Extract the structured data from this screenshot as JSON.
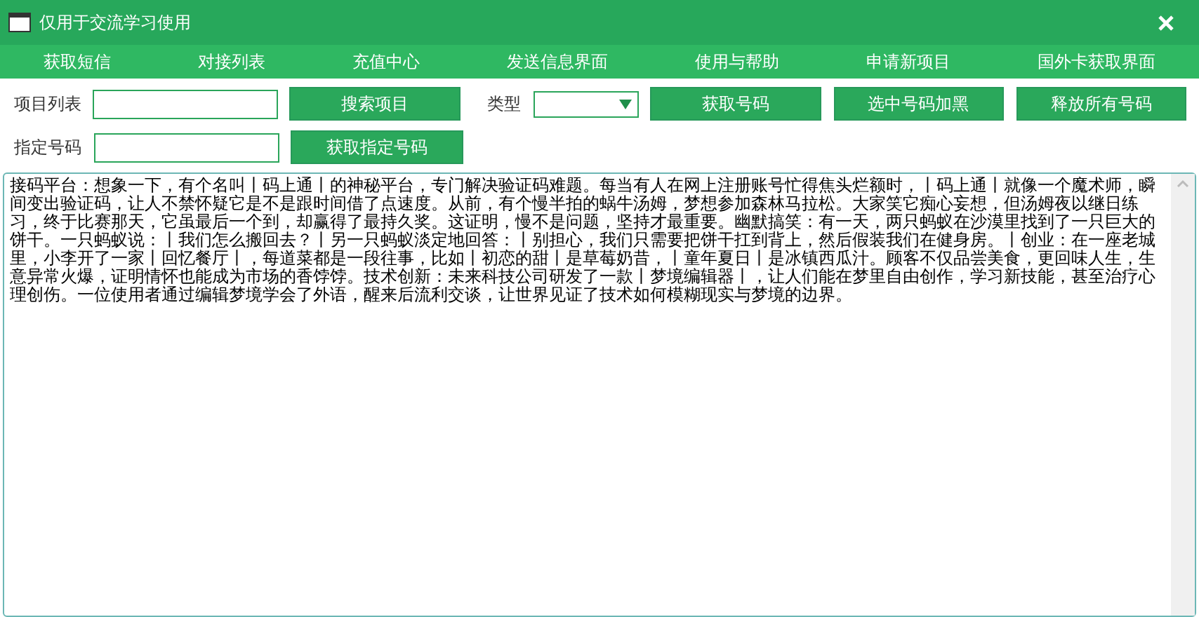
{
  "window": {
    "title": "仅用于交流学习使用"
  },
  "menu": [
    {
      "label": "获取短信"
    },
    {
      "label": "对接列表"
    },
    {
      "label": "充值中心"
    },
    {
      "label": "发送信息界面"
    },
    {
      "label": "使用与帮助"
    },
    {
      "label": "申请新项目"
    },
    {
      "label": "国外卡获取界面"
    }
  ],
  "row1": {
    "project_label": "项目列表",
    "search_button": "搜索项目",
    "type_label": "类型",
    "buttons": [
      "获取号码",
      "选中号码加黑",
      "释放所有号码"
    ]
  },
  "row2": {
    "number_label": "指定号码",
    "button": "获取指定号码"
  },
  "log": {
    "text": "接码平台：想象一下，有个名叫丨码上通丨的神秘平台，专门解决验证码难题。每当有人在网上注册账号忙得焦头烂额时，丨码上通丨就像一个魔术师，瞬间变出验证码，让人不禁怀疑它是不是跟时间借了点速度。从前，有个慢半拍的蜗牛汤姆，梦想参加森林马拉松。大家笑它痴心妄想，但汤姆夜以继日练习，终于比赛那天，它虽最后一个到，却赢得了最持久奖。这证明，慢不是问题，坚持才最重要。幽默搞笑：有一天，两只蚂蚁在沙漠里找到了一只巨大的饼干。一只蚂蚁说：丨我们怎么搬回去？丨另一只蚂蚁淡定地回答：丨别担心，我们只需要把饼干扛到背上，然后假装我们在健身房。丨创业：在一座老城里，小李开了一家丨回忆餐厅丨，每道菜都是一段往事，比如丨初恋的甜丨是草莓奶昔，丨童年夏日丨是冰镇西瓜汁。顾客不仅品尝美食，更回味人生，生意异常火爆，证明情怀也能成为市场的香饽饽。技术创新：未来科技公司研发了一款丨梦境编辑器丨，让人们能在梦里自由创作，学习新技能，甚至治疗心理创伤。一位使用者通过编辑梦境学会了外语，醒来后流利交谈，让世界见证了技术如何模糊现实与梦境的边界。"
  }
}
